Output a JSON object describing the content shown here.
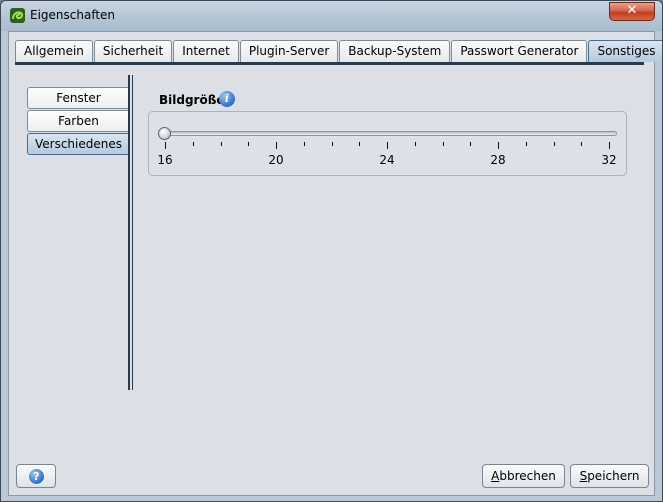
{
  "window": {
    "title": "Eigenschaften",
    "close_label": "✕"
  },
  "tabs": [
    {
      "label": "Allgemein",
      "active": false
    },
    {
      "label": "Sicherheit",
      "active": false
    },
    {
      "label": "Internet",
      "active": false
    },
    {
      "label": "Plugin-Server",
      "active": false
    },
    {
      "label": "Backup-System",
      "active": false
    },
    {
      "label": "Passwort Generator",
      "active": false
    },
    {
      "label": "Sonstiges",
      "active": true
    }
  ],
  "sidenav": [
    {
      "label": "Fenster",
      "active": false
    },
    {
      "label": "Farben",
      "active": false
    },
    {
      "label": "Verschiedenes",
      "active": true
    }
  ],
  "section": {
    "label": "Bildgröße",
    "info_icon": "info-icon"
  },
  "slider": {
    "min": 16,
    "max": 32,
    "value": 16,
    "minor_step": 1,
    "tick_labels": [
      "16",
      "20",
      "24",
      "28",
      "32"
    ]
  },
  "footer": {
    "help_icon": "help-icon",
    "help_glyph": "?",
    "cancel": {
      "mnemonic": "A",
      "rest": "bbrechen"
    },
    "save": {
      "mnemonic": "S",
      "rest": "peichern"
    }
  },
  "colors": {
    "accent": "#2f6fc4",
    "tab_active": "#b4c9de"
  }
}
